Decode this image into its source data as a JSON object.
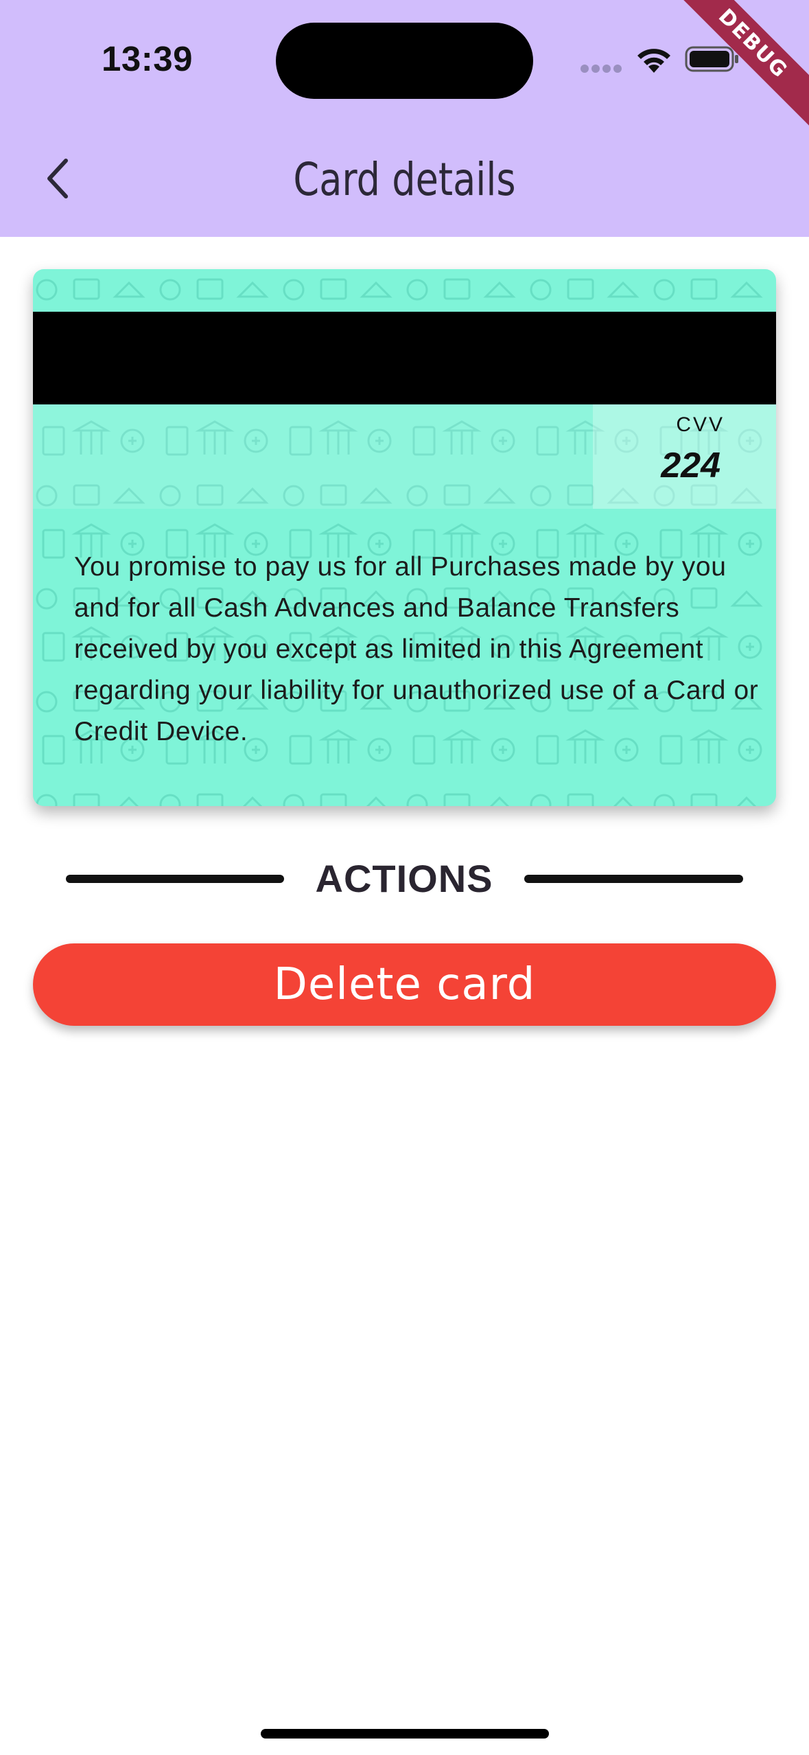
{
  "status_bar": {
    "time": "13:39",
    "debug_label": "DEBUG"
  },
  "header": {
    "title": "Card details",
    "back_icon": "chevron-left-icon",
    "background_color": "#d1bdfc"
  },
  "card": {
    "background_color": "#7ff4d8",
    "cvv_label": "CVV",
    "cvv_value": "224",
    "terms": "You promise to pay us for all Purchases made by you and for all Cash Advances and Balance Transfers received by you except as limited in this Agreement regarding your liability for unauthorized use of a Card or Credit Device."
  },
  "actions": {
    "section_label": "ACTIONS",
    "delete_label": "Delete card",
    "delete_color": "#f44336"
  }
}
